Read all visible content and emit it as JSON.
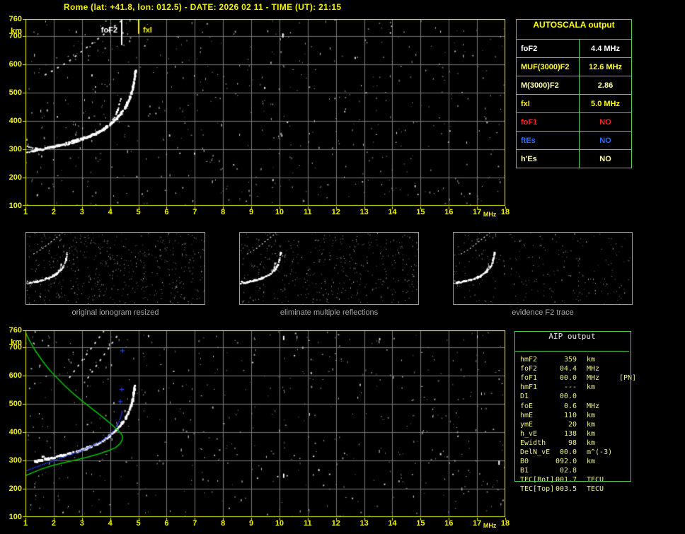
{
  "header": {
    "title": "Rome (lat: +41.8, lon: 012.5) - DATE: 2026 02 11 - TIME (UT): 21:15"
  },
  "colors": {
    "accent": "#f2f200",
    "grid": "#7a7a7a",
    "green_border": "#55cc55",
    "trace_white": "#ffffff",
    "fitted_blue": "#2040ff",
    "profile_green": "#00c400",
    "caption_gray": "#a8a8a8"
  },
  "autoscala_table": {
    "title": "AUTOSCALA output",
    "rows": [
      {
        "label": "foF2",
        "value": "4.4 MHz",
        "color": "#ffffff"
      },
      {
        "label": "MUF(3000)F2",
        "value": "12.6 MHz",
        "color": "#ffff33"
      },
      {
        "label": "M(3000)F2",
        "value": "2.86",
        "color": "#ffffaa"
      },
      {
        "label": "fxI",
        "value": "5.0 MHz",
        "color": "#ffff00"
      },
      {
        "label": "foF1",
        "value": "NO",
        "color": "#ff2020"
      },
      {
        "label": "ftEs",
        "value": "NO",
        "color": "#2f6bff"
      },
      {
        "label": "h'Es",
        "value": "NO",
        "color": "#ffffaa"
      }
    ]
  },
  "aip_table": {
    "title": "AIP output",
    "rows": [
      {
        "label": "hmF2",
        "value": "359",
        "unit": "km",
        "note": ""
      },
      {
        "label": "foF2",
        "value": "04.4",
        "unit": "MHz",
        "note": ""
      },
      {
        "label": "foF1",
        "value": "00.0",
        "unit": "MHz",
        "note": "[PN]"
      },
      {
        "label": "hmF1",
        "value": "---",
        "unit": "km",
        "note": ""
      },
      {
        "label": "D1",
        "value": "00.0",
        "unit": "",
        "note": ""
      },
      {
        "label": "foE",
        "value": "0.6",
        "unit": "MHz",
        "note": ""
      },
      {
        "label": "hmE",
        "value": "110",
        "unit": "km",
        "note": ""
      },
      {
        "label": "ymE",
        "value": "20",
        "unit": "km",
        "note": ""
      },
      {
        "label": "h_vE",
        "value": "138",
        "unit": "km",
        "note": ""
      },
      {
        "label": "Ewidth",
        "value": "98",
        "unit": "km",
        "note": ""
      },
      {
        "label": "DelN_vE",
        "value": "00.0",
        "unit": "m^(-3)",
        "note": ""
      },
      {
        "label": "B0",
        "value": "092.0",
        "unit": "km",
        "note": ""
      },
      {
        "label": "B1",
        "value": "02.8",
        "unit": "",
        "note": ""
      },
      {
        "label": "TEC[Bot]",
        "value": "001.7",
        "unit": "TECU",
        "note": ""
      },
      {
        "label": "TEC[Top]",
        "value": "003.5",
        "unit": "TECU",
        "note": ""
      }
    ]
  },
  "thumbnails": [
    {
      "caption": "original ionogram resized",
      "seed": 31,
      "noise_count": 520
    },
    {
      "caption": "eliminate multiple reflections",
      "seed": 47,
      "noise_count": 430
    },
    {
      "caption": "evidence F2 trace",
      "seed": 59,
      "noise_count": 250
    }
  ],
  "chart_data": [
    {
      "type": "scatter",
      "name": "scaled ionogram with autoscaled characteristics",
      "xlabel": "MHz",
      "ylabel": "km",
      "xlim": [
        1,
        18
      ],
      "ylim": [
        100,
        760
      ],
      "grid": true,
      "xticks": [
        1,
        2,
        3,
        4,
        5,
        6,
        7,
        8,
        9,
        10,
        11,
        12,
        13,
        14,
        15,
        16,
        17,
        18
      ],
      "yticks": [
        760,
        700,
        600,
        500,
        400,
        300,
        200,
        100
      ],
      "markers": [
        {
          "label": "foF2",
          "x": 4.4,
          "color": "#ffffff",
          "to_km": 668,
          "side": "left"
        },
        {
          "label": "fxI",
          "x": 5.0,
          "color": "#f4f400",
          "to_km": 708,
          "side": "right"
        }
      ],
      "bright_marks": [
        [
          10.12,
          702
        ]
      ],
      "noise": {
        "seed": 11,
        "count": 560,
        "bright": 26
      },
      "series": [
        {
          "name": "F2 trace O-mode",
          "style": "blobs",
          "color": "#ffffff",
          "width": 2,
          "points": [
            [
              1.05,
              289
            ],
            [
              1.35,
              294
            ],
            [
              1.7,
              301
            ],
            [
              2.05,
              308
            ],
            [
              2.4,
              315
            ],
            [
              2.75,
              324
            ],
            [
              3.05,
              334
            ],
            [
              3.35,
              346
            ],
            [
              3.6,
              358
            ],
            [
              3.82,
              372
            ],
            [
              4.0,
              389
            ],
            [
              4.13,
              407
            ],
            [
              4.23,
              427
            ],
            [
              4.3,
              447
            ],
            [
              4.35,
              466
            ],
            [
              4.38,
              483
            ]
          ]
        },
        {
          "name": "F2 trace X-mode",
          "style": "blobs",
          "color": "#ffffff",
          "width": 3,
          "points": [
            [
              1.35,
              296
            ],
            [
              1.7,
              303
            ],
            [
              2.1,
              312
            ],
            [
              2.5,
              322
            ],
            [
              2.85,
              332
            ],
            [
              3.2,
              344
            ],
            [
              3.5,
              356
            ],
            [
              3.75,
              369
            ],
            [
              3.95,
              383
            ],
            [
              4.15,
              400
            ],
            [
              4.35,
              421
            ],
            [
              4.52,
              443
            ],
            [
              4.65,
              467
            ],
            [
              4.75,
              493
            ],
            [
              4.82,
              521
            ],
            [
              4.87,
              549
            ],
            [
              4.9,
              573
            ],
            [
              4.91,
              583
            ]
          ]
        },
        {
          "name": "trace fork",
          "style": "blobs",
          "color": "#ffffff",
          "width": 2,
          "points": [
            [
              1.08,
              311
            ],
            [
              1.3,
              304
            ],
            [
              1.5,
              299
            ]
          ]
        },
        {
          "name": "second reflection streak",
          "style": "dashed",
          "color": "#d6d6d6",
          "width": 2,
          "points": [
            [
              1.68,
              562
            ],
            [
              2.5,
              608
            ],
            [
              4.45,
              758
            ]
          ]
        }
      ]
    },
    {
      "type": "scatter",
      "name": "ionogram with fitted trace and electron density profile",
      "xlabel": "MHz",
      "ylabel": "km",
      "xlim": [
        1,
        18
      ],
      "ylim": [
        100,
        760
      ],
      "grid": true,
      "xticks": [
        1,
        2,
        3,
        4,
        5,
        6,
        7,
        8,
        9,
        10,
        11,
        12,
        13,
        14,
        15,
        16,
        17,
        18
      ],
      "yticks": [
        760,
        700,
        600,
        500,
        400,
        300,
        200,
        100
      ],
      "markers": [],
      "bright_marks": [
        [
          10.15,
          733
        ],
        [
          10.15,
          246
        ],
        [
          17.78,
          292
        ]
      ],
      "noise": {
        "seed": 23,
        "count": 540,
        "bright": 24
      },
      "series": [
        {
          "name": "F2 trace",
          "style": "blobs",
          "color": "#ffffff",
          "width": 3,
          "points": [
            [
              1.35,
              296
            ],
            [
              1.7,
              303
            ],
            [
              2.1,
              312
            ],
            [
              2.5,
              322
            ],
            [
              2.85,
              332
            ],
            [
              3.2,
              344
            ],
            [
              3.5,
              356
            ],
            [
              3.75,
              369
            ],
            [
              3.95,
              383
            ],
            [
              4.15,
              400
            ],
            [
              4.35,
              421
            ],
            [
              4.52,
              443
            ],
            [
              4.65,
              467
            ],
            [
              4.75,
              493
            ],
            [
              4.82,
              521
            ],
            [
              4.86,
              550
            ],
            [
              4.89,
              574
            ]
          ]
        },
        {
          "name": "trace fork",
          "style": "blobs",
          "color": "#ffffff",
          "width": 2,
          "points": [
            [
              1.5,
              318
            ],
            [
              1.75,
              309
            ],
            [
              2.0,
              304
            ]
          ]
        },
        {
          "name": "second reflection streak 1",
          "style": "dashed",
          "color": "#d6d6d6",
          "width": 2,
          "points": [
            [
              2.55,
              592
            ],
            [
              3.78,
              757
            ]
          ]
        },
        {
          "name": "second reflection streak 2",
          "style": "dashed",
          "color": "#d6d6d6",
          "width": 2,
          "points": [
            [
              3.2,
              590
            ],
            [
              4.32,
              750
            ]
          ]
        },
        {
          "name": "fitted trace",
          "style": "dots",
          "color": "#2040ff",
          "points": [
            [
              1.0,
              262
            ],
            [
              1.3,
              274
            ],
            [
              1.6,
              285
            ],
            [
              1.9,
              296
            ],
            [
              2.2,
              306
            ],
            [
              2.5,
              317
            ],
            [
              2.8,
              328
            ],
            [
              3.1,
              340
            ],
            [
              3.4,
              353
            ],
            [
              3.65,
              366
            ],
            [
              3.85,
              379
            ],
            [
              4.02,
              393
            ],
            [
              4.15,
              408
            ],
            [
              4.26,
              425
            ],
            [
              4.34,
              444
            ],
            [
              4.4,
              462
            ],
            [
              4.43,
              478
            ]
          ]
        },
        {
          "name": "fitted trace markers",
          "style": "plus",
          "color": "#2040ff",
          "points": [
            [
              4.36,
              508
            ],
            [
              4.41,
              551
            ],
            [
              4.44,
              688
            ]
          ]
        },
        {
          "name": "electron density profile",
          "style": "line",
          "color": "#00c400",
          "width": 1.5,
          "points": [
            [
              1.0,
              752
            ],
            [
              1.15,
              722
            ],
            [
              1.35,
              688
            ],
            [
              1.6,
              652
            ],
            [
              1.85,
              620
            ],
            [
              2.1,
              594
            ],
            [
              2.4,
              563
            ],
            [
              2.7,
              536
            ],
            [
              3.0,
              511
            ],
            [
              3.3,
              487
            ],
            [
              3.6,
              464
            ],
            [
              3.85,
              444
            ],
            [
              4.05,
              427
            ],
            [
              4.25,
              409
            ],
            [
              4.38,
              396
            ],
            [
              4.44,
              386
            ],
            [
              4.43,
              374
            ],
            [
              4.36,
              360
            ],
            [
              4.2,
              346
            ],
            [
              3.95,
              335
            ],
            [
              3.6,
              323
            ],
            [
              3.2,
              312
            ],
            [
              2.8,
              302
            ],
            [
              2.4,
              293
            ],
            [
              2.0,
              283
            ],
            [
              1.6,
              271
            ],
            [
              1.3,
              259
            ],
            [
              1.0,
              246
            ]
          ]
        }
      ]
    }
  ]
}
